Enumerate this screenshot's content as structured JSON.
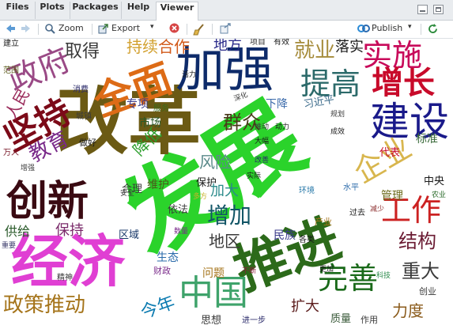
{
  "tabs": [
    {
      "label": "Files"
    },
    {
      "label": "Plots"
    },
    {
      "label": "Packages"
    },
    {
      "label": "Help"
    },
    {
      "label": "Viewer"
    }
  ],
  "toolbar": {
    "zoom_label": "Zoom",
    "export_label": "Export",
    "export_caret": "▾",
    "publish_label": "Publish",
    "publish_caret": "▾"
  },
  "wordcloud": {
    "words": [
      {
        "text": "发展",
        "color": "#2bd32b"
      },
      {
        "text": "改革",
        "color": "#6b5a14"
      },
      {
        "text": "经济",
        "color": "#e03fd3"
      },
      {
        "text": "推进",
        "color": "#2c6a1a"
      },
      {
        "text": "加强",
        "color": "#0e2b6a"
      },
      {
        "text": "创新",
        "color": "#3a0a12"
      },
      {
        "text": "建设",
        "color": "#1a1a8a"
      },
      {
        "text": "全面",
        "color": "#dd6b16"
      },
      {
        "text": "中国",
        "color": "#3fa36b"
      },
      {
        "text": "坚持",
        "color": "#7c0a18"
      },
      {
        "text": "政府",
        "color": "#9a4a86"
      },
      {
        "text": "增长",
        "color": "#c80a2a"
      },
      {
        "text": "提高",
        "color": "#2c6a6a"
      },
      {
        "text": "实施",
        "color": "#c80a5a"
      },
      {
        "text": "工作",
        "color": "#cc2222"
      },
      {
        "text": "完善",
        "color": "#1a6a1a"
      },
      {
        "text": "企业",
        "color": "#d8b64e"
      },
      {
        "text": "政策推动",
        "color": "#a5741a"
      },
      {
        "text": "教育",
        "color": "#7a2a8a"
      },
      {
        "text": "就业",
        "color": "#a58b3a"
      },
      {
        "text": "增加",
        "color": "#115566"
      },
      {
        "text": "结构",
        "color": "#6a1a32"
      },
      {
        "text": "重大",
        "color": "#3a3a3a"
      },
      {
        "text": "群众",
        "color": "#4a3a1a"
      },
      {
        "text": "持续",
        "color": "#d2a02e"
      },
      {
        "text": "合作",
        "color": "#d25a1a"
      },
      {
        "text": "取得",
        "color": "#3a3a3a"
      },
      {
        "text": "地方",
        "color": "#2a2a8a"
      },
      {
        "text": "落实",
        "color": "#1a1a1a"
      },
      {
        "text": "今年",
        "color": "#0a7ab0"
      },
      {
        "text": "人民",
        "color": "#9a2a5a"
      },
      {
        "text": "风险",
        "color": "#5a8a8a"
      },
      {
        "text": "降低",
        "color": "#2b9e2b"
      },
      {
        "text": "地区",
        "color": "#3a3a3a"
      },
      {
        "text": "力度",
        "color": "#8a5a1a"
      },
      {
        "text": "保持",
        "color": "#7a2a6a"
      },
      {
        "text": "加大",
        "color": "#2a8a8a"
      },
      {
        "text": "供给",
        "color": "#2a5a2a"
      },
      {
        "text": "扩大",
        "color": "#5a1a1a"
      },
      {
        "text": "市场",
        "color": "#2a5a2a"
      },
      {
        "text": "维护",
        "color": "#4a5a1a"
      },
      {
        "text": "问题",
        "color": "#a5741a"
      },
      {
        "text": "生态",
        "color": "#2a6aaa"
      },
      {
        "text": "标准",
        "color": "#3a6a3a"
      },
      {
        "text": "管理",
        "color": "#6a6a1a"
      },
      {
        "text": "下降",
        "color": "#3a6aaa"
      },
      {
        "text": "专项",
        "color": "#3a3a8a"
      },
      {
        "text": "合理",
        "color": "#3a3a3a"
      },
      {
        "text": "区域",
        "color": "#1a3a6a"
      },
      {
        "text": "民族",
        "color": "#3a3a8a"
      },
      {
        "text": "依法",
        "color": "#3a3a3a"
      },
      {
        "text": "保护",
        "color": "#1a1a1a"
      },
      {
        "text": "代表",
        "color": "#c80a2a"
      },
      {
        "text": "中央",
        "color": "#1a1a1a"
      },
      {
        "text": "质量",
        "color": "#3a5a3a"
      },
      {
        "text": "思想",
        "color": "#3a3a3a"
      },
      {
        "text": "作用",
        "color": "#3a3a3a"
      },
      {
        "text": "创业",
        "color": "#3a3a3a"
      },
      {
        "text": "服务",
        "color": "#3a6a1a"
      },
      {
        "text": "习近平",
        "color": "#3a6a8a"
      },
      {
        "text": "做好",
        "color": "#1a1a1a"
      },
      {
        "text": "财政",
        "color": "#7a2a8a"
      },
      {
        "text": "消费",
        "color": "#2a2a6a"
      },
      {
        "text": "城镇",
        "color": "#3a3a3a"
      },
      {
        "text": "精神",
        "color": "#3a3a3a"
      },
      {
        "text": "万人",
        "color": "#7a1a2a"
      },
      {
        "text": "各类",
        "color": "#1a1a1a"
      },
      {
        "text": "环境",
        "color": "#2a7aaa"
      },
      {
        "text": "水平",
        "color": "#2a6aaa"
      },
      {
        "text": "产业",
        "color": "#a5741a"
      },
      {
        "text": "减少",
        "color": "#8a2a2a"
      },
      {
        "text": "过去",
        "color": "#1a1a1a"
      },
      {
        "text": "项目",
        "color": "#2a2a2a"
      },
      {
        "text": "有效",
        "color": "#1a1a1a"
      },
      {
        "text": "建立",
        "color": "#1a1a1a"
      },
      {
        "text": "活力",
        "color": "#1a1a1a"
      },
      {
        "text": "范围",
        "color": "#5a5a1a"
      },
      {
        "text": "深化",
        "color": "#3a3a3a"
      },
      {
        "text": "推动",
        "color": "#3a3a3a"
      },
      {
        "text": "规划",
        "color": "#3a3a3a"
      },
      {
        "text": "大幅",
        "color": "#1a1a1a"
      },
      {
        "text": "动力",
        "color": "#1a1a1a"
      },
      {
        "text": "成效",
        "color": "#1a1a1a"
      },
      {
        "text": "农业",
        "color": "#2a6a2a"
      },
      {
        "text": "重要",
        "color": "#3a3a6a"
      },
      {
        "text": "更加",
        "color": "#1a1a1a"
      },
      {
        "text": "进一步",
        "color": "#2a2a6a"
      },
      {
        "text": "科技",
        "color": "#2a8a4a"
      },
      {
        "text": "增强",
        "color": "#3a3a3a"
      },
      {
        "text": "安全",
        "color": "#3a3a3a"
      },
      {
        "text": "不断",
        "color": "#8a1a3a"
      },
      {
        "text": "数量",
        "color": "#7a2a8a"
      },
      {
        "text": "多方",
        "color": "#c8b22a"
      },
      {
        "text": "实际",
        "color": "#1a1a1a"
      },
      {
        "text": "改善",
        "color": "#2a2a6a"
      }
    ]
  }
}
